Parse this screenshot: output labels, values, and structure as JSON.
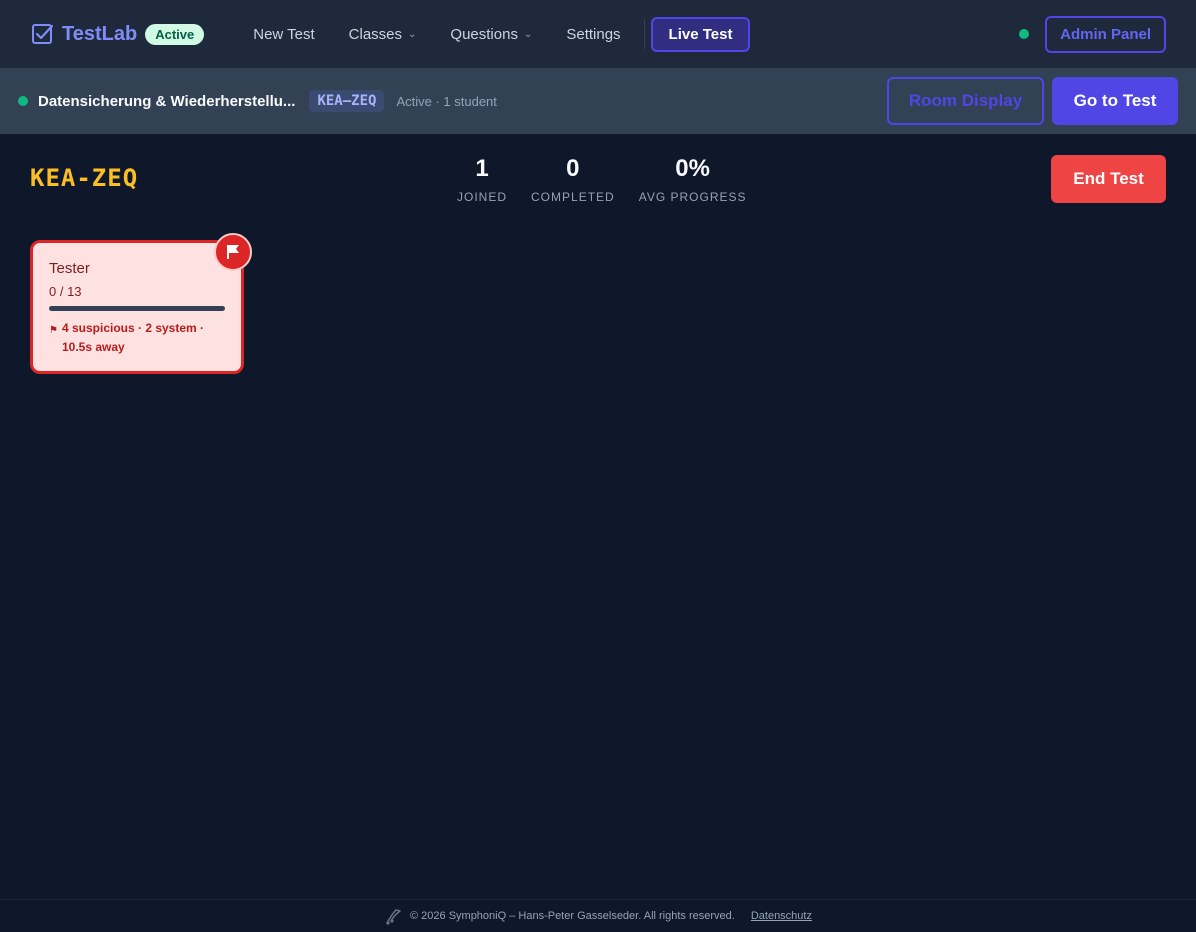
{
  "nav": {
    "brand": "TestLab",
    "status_badge": "Active",
    "links": [
      "New Test",
      "Classes",
      "Questions",
      "Settings"
    ],
    "live_test": "Live Test",
    "admin_panel": "Admin Panel"
  },
  "session": {
    "title": "Datensicherung & Wiederherstellu...",
    "code": "KEA–ZEQ",
    "status": "Active · 1 student",
    "room_display": "Room Display",
    "go_to_test": "Go to Test"
  },
  "main": {
    "code": "KEA-ZEQ",
    "stats": [
      {
        "value": "1",
        "label": "JOINED"
      },
      {
        "value": "0",
        "label": "COMPLETED"
      },
      {
        "value": "0%",
        "label": "AVG PROGRESS"
      }
    ],
    "end_test": "End Test"
  },
  "students": [
    {
      "name": "Tester",
      "progress_text": "0 / 13",
      "progress": 0,
      "flags": "4 suspicious · 2 system · 10.5s away"
    }
  ],
  "footer": {
    "copyright": "© 2026 SymphoniQ – Hans-Peter Gasselseder. All rights reserved.",
    "privacy": "Datenschutz"
  },
  "colors": {
    "accent": "#4f46e5",
    "danger": "#ef4444",
    "code": "#fbbf24",
    "online": "#10b981"
  }
}
